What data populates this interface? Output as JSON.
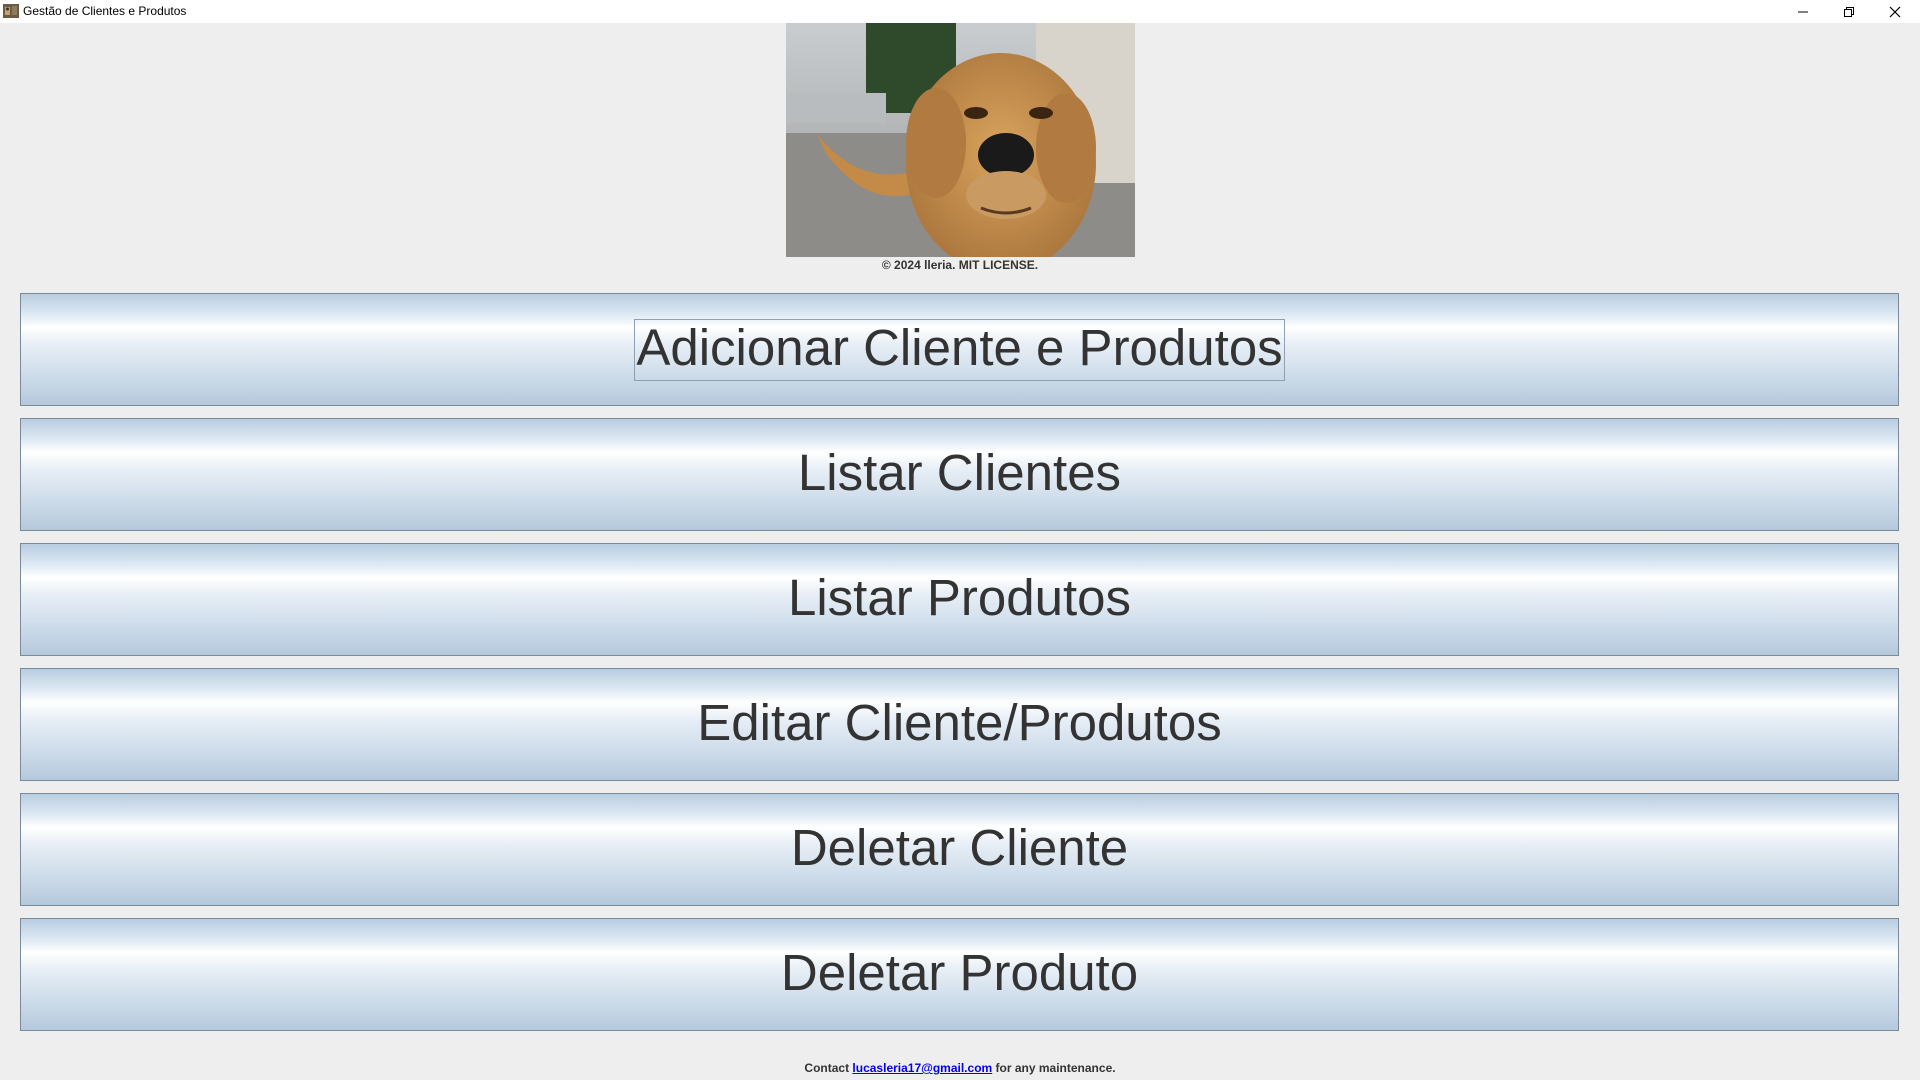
{
  "window": {
    "title": "Gestão de Clientes e Produtos",
    "icon": "app-photo-icon",
    "controls": [
      "minimize-icon",
      "restore-icon",
      "close-icon"
    ]
  },
  "header": {
    "image": "dog-photo",
    "copyright": "© 2024 lleria. MIT LICENSE."
  },
  "buttons": [
    {
      "label": "Adicionar Cliente e Produtos",
      "focused": true
    },
    {
      "label": "Listar Clientes"
    },
    {
      "label": "Listar Produtos"
    },
    {
      "label": "Editar Cliente/Produtos"
    },
    {
      "label": "Deletar Cliente"
    },
    {
      "label": "Deletar Produto"
    }
  ],
  "footer": {
    "prefix": "Contact ",
    "email": "lucasleria17@gmail.com",
    "suffix": " for any maintenance."
  },
  "colors": {
    "background": "#eeeeee",
    "button_text": "#333333",
    "link": "#0000ee"
  }
}
